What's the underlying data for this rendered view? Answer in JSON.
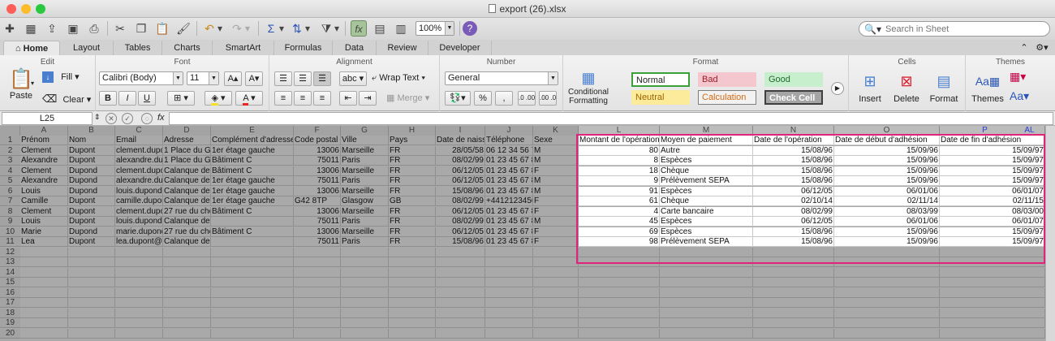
{
  "window": {
    "title": "export (26).xlsx",
    "traffic_lights": [
      {
        "name": "close",
        "color": "#fc5f57"
      },
      {
        "name": "minimize",
        "color": "#fdbc2e"
      },
      {
        "name": "zoom",
        "color": "#28c840"
      }
    ]
  },
  "toolbar": {
    "zoom_value": "100%",
    "search_placeholder": "Search in Sheet",
    "icons": [
      "new-icon",
      "templates-icon",
      "open-icon",
      "save-icon",
      "print-icon",
      "cut-icon",
      "copy-icon",
      "paste-icon",
      "format-painter-icon",
      "undo-icon",
      "redo-icon",
      "autosum-icon",
      "sort-icon",
      "filter-icon",
      "formula-builder-icon",
      "gallery-icon",
      "media-icon",
      "help-icon"
    ]
  },
  "ribbon": {
    "tabs": [
      "Home",
      "Layout",
      "Tables",
      "Charts",
      "SmartArt",
      "Formulas",
      "Data",
      "Review",
      "Developer"
    ],
    "active_tab": "Home",
    "groups": {
      "edit": {
        "label": "Edit",
        "paste": "Paste",
        "fill": "Fill",
        "clear": "Clear"
      },
      "font": {
        "label": "Font",
        "family": "Calibri (Body)",
        "size": "11"
      },
      "alignment": {
        "label": "Alignment",
        "wrap_text": "Wrap Text",
        "merge": "Merge",
        "abc": "abc"
      },
      "number": {
        "label": "Number",
        "format": "General"
      },
      "format": {
        "label": "Format",
        "conditional": [
          "Conditional",
          "Formatting"
        ],
        "styles": [
          {
            "name": "Normal",
            "bg": "#ffffff",
            "fg": "#222222",
            "border": "#3aa13a"
          },
          {
            "name": "Bad",
            "bg": "#f4c7ce",
            "fg": "#9c1c2a",
            "border": "#f4c7ce"
          },
          {
            "name": "Good",
            "bg": "#c7efce",
            "fg": "#1e6b2c",
            "border": "#c7efce"
          },
          {
            "name": "Neutral",
            "bg": "#fdeb9c",
            "fg": "#9c6500",
            "border": "#fdeb9c"
          },
          {
            "name": "Calculation",
            "bg": "#f2f2f2",
            "fg": "#d46a10",
            "border": "#7f7f7f"
          },
          {
            "name": "Check Cell",
            "bg": "#a5a5a5",
            "fg": "#ffffff",
            "border": "#3f3f3f"
          }
        ]
      },
      "cells": {
        "label": "Cells",
        "insert": "Insert",
        "delete": "Delete",
        "format": "Format"
      },
      "themes": {
        "label": "Themes",
        "themes": "Themes",
        "aa": "Aa"
      }
    }
  },
  "formula_bar": {
    "name_box": "L25",
    "fx": "fx",
    "content": ""
  },
  "sheet": {
    "columns": [
      "A",
      "B",
      "C",
      "D",
      "E",
      "F",
      "G",
      "H",
      "I",
      "J",
      "K",
      "L",
      "M",
      "N",
      "O",
      "P",
      "AL"
    ],
    "row_count": 20,
    "header_row": [
      "Prénom",
      "Nom",
      "Email",
      "Adresse",
      "Complément d'adresse",
      "Code postal",
      "Ville",
      "Pays",
      "Date de naissa",
      "Téléphone",
      "Sexe"
    ],
    "rows": [
      [
        "Clement",
        "Dupont",
        "clement.dupo",
        "1 Place du Gé",
        "1er étage gauche",
        "13006",
        "Marseille",
        "FR",
        "28/05/58",
        "06 12 34 56 78",
        "M"
      ],
      [
        "Alexandre",
        "Dupont",
        "alexandre.dup",
        "1 Place du Gé",
        "Bâtiment C",
        "75011",
        "Paris",
        "FR",
        "08/02/99",
        "01 23 45 67 89",
        "M"
      ],
      [
        "Clement",
        "Dupond",
        "clement.dupo",
        "Calanque de S",
        "Bâtiment C",
        "13006",
        "Marseille",
        "FR",
        "06/12/05",
        "01 23 45 67 89",
        "F"
      ],
      [
        "Alexandre",
        "Dupond",
        "alexandre.dup",
        "Calanque de S",
        "1er étage gauche",
        "75011",
        "Paris",
        "FR",
        "06/12/05",
        "01 23 45 67 89",
        "M"
      ],
      [
        "Louis",
        "Dupond",
        "louis.dupond(",
        "Calanque de S",
        "1er étage gauche",
        "13006",
        "Marseille",
        "FR",
        "15/08/96",
        "01 23 45 67 89",
        "M"
      ],
      [
        "Camille",
        "Dupont",
        "camille.dupor",
        "Calanque de S",
        "1er étage gauche",
        "G42 8TP",
        "Glasgow",
        "GB",
        "08/02/99",
        "+4412123456",
        "F"
      ],
      [
        "Clement",
        "Dupont",
        "clement.dupo",
        "27 rue du che",
        "Bâtiment C",
        "13006",
        "Marseille",
        "FR",
        "06/12/05",
        "01 23 45 67 89",
        "F"
      ],
      [
        "Louis",
        "Dupont",
        "louis.dupond(",
        "Calanque de S",
        "",
        "75011",
        "Paris",
        "FR",
        "08/02/99",
        "01 23 45 67 89",
        "M"
      ],
      [
        "Marie",
        "Dupond",
        "marie.dupond",
        "27 rue du che",
        "Bâtiment C",
        "13006",
        "Marseille",
        "FR",
        "06/12/05",
        "01 23 45 67 89",
        "F"
      ],
      [
        "Lea",
        "Dupont",
        "lea.dupont@e",
        "Calanque de S",
        "",
        "75011",
        "Paris",
        "FR",
        "15/08/96",
        "01 23 45 67 89",
        "F"
      ]
    ],
    "right_header": [
      "Montant de l'opération",
      "Moyen de paiement",
      "Date de l'opération",
      "Date de début d'adhésion",
      "Date de fin d'adhésion"
    ],
    "right_rows": [
      [
        "80",
        "Autre",
        "15/08/96",
        "15/09/96",
        "15/09/97"
      ],
      [
        "8",
        "Espèces",
        "15/08/96",
        "15/09/96",
        "15/09/97"
      ],
      [
        "18",
        "Chèque",
        "15/08/96",
        "15/09/96",
        "15/09/97"
      ],
      [
        "9",
        "Prélèvement SEPA",
        "15/08/96",
        "15/09/96",
        "15/09/97"
      ],
      [
        "91",
        "Espèces",
        "06/12/05",
        "06/01/06",
        "06/01/07"
      ],
      [
        "61",
        "Chèque",
        "02/10/14",
        "02/11/14",
        "02/11/15"
      ],
      [
        "4",
        "Carte bancaire",
        "08/02/99",
        "08/03/99",
        "08/03/00"
      ],
      [
        "45",
        "Espèces",
        "06/12/05",
        "06/01/06",
        "06/01/07"
      ],
      [
        "69",
        "Espèces",
        "15/08/96",
        "15/09/96",
        "15/09/97"
      ],
      [
        "98",
        "Prélèvement SEPA",
        "15/08/96",
        "15/09/96",
        "15/09/97"
      ]
    ],
    "colors": {
      "highlight_border": "#e2237c",
      "blue_header": "#2a3bd6"
    }
  }
}
